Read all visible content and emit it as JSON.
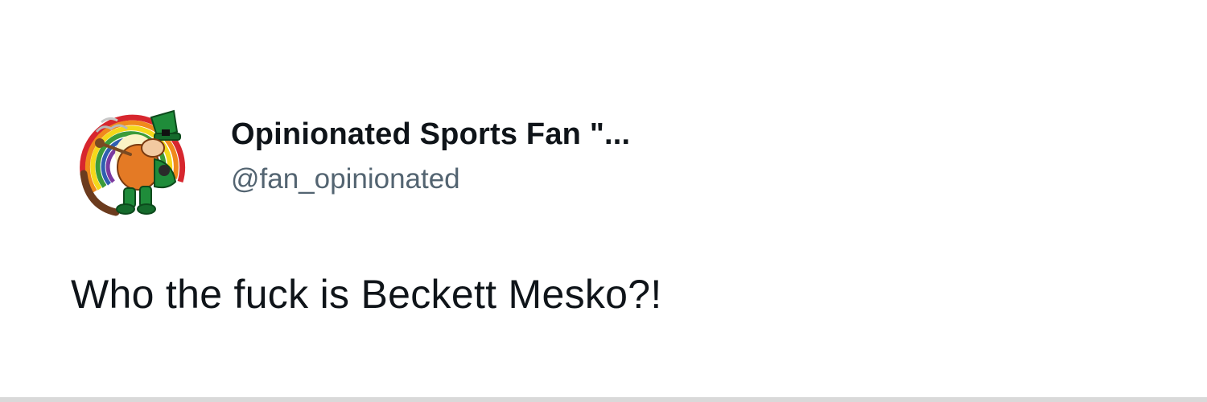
{
  "tweet": {
    "avatar_icon": "leprechaun-rainbow-avatar-icon",
    "display_name": "Opinionated Sports Fan \"...",
    "handle": "@fan_opinionated",
    "text": "Who the fuck is Beckett Mesko?!"
  },
  "colors": {
    "background": "#ffffff",
    "primary_text": "#0f1419",
    "secondary_text": "#536471"
  }
}
